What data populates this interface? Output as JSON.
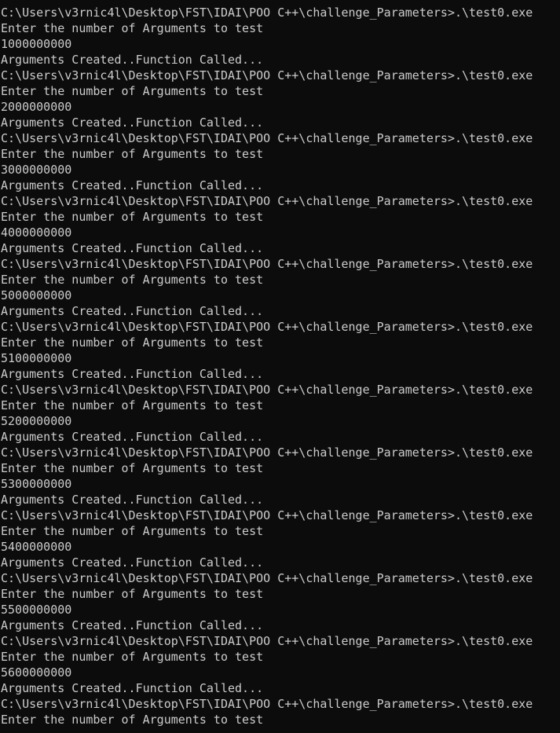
{
  "terminal": {
    "lines": [
      "C:\\Users\\v3rnic4l\\Desktop\\FST\\IDAI\\POO C++\\challenge_Parameters>.\\test0.exe",
      "Enter the number of Arguments to test",
      "1000000000",
      "Arguments Created..Function Called...",
      "C:\\Users\\v3rnic4l\\Desktop\\FST\\IDAI\\POO C++\\challenge_Parameters>.\\test0.exe",
      "Enter the number of Arguments to test",
      "2000000000",
      "Arguments Created..Function Called...",
      "C:\\Users\\v3rnic4l\\Desktop\\FST\\IDAI\\POO C++\\challenge_Parameters>.\\test0.exe",
      "Enter the number of Arguments to test",
      "3000000000",
      "Arguments Created..Function Called...",
      "C:\\Users\\v3rnic4l\\Desktop\\FST\\IDAI\\POO C++\\challenge_Parameters>.\\test0.exe",
      "Enter the number of Arguments to test",
      "4000000000",
      "Arguments Created..Function Called...",
      "C:\\Users\\v3rnic4l\\Desktop\\FST\\IDAI\\POO C++\\challenge_Parameters>.\\test0.exe",
      "Enter the number of Arguments to test",
      "5000000000",
      "Arguments Created..Function Called...",
      "C:\\Users\\v3rnic4l\\Desktop\\FST\\IDAI\\POO C++\\challenge_Parameters>.\\test0.exe",
      "Enter the number of Arguments to test",
      "5100000000",
      "Arguments Created..Function Called...",
      "C:\\Users\\v3rnic4l\\Desktop\\FST\\IDAI\\POO C++\\challenge_Parameters>.\\test0.exe",
      "Enter the number of Arguments to test",
      "5200000000",
      "Arguments Created..Function Called...",
      "C:\\Users\\v3rnic4l\\Desktop\\FST\\IDAI\\POO C++\\challenge_Parameters>.\\test0.exe",
      "Enter the number of Arguments to test",
      "5300000000",
      "Arguments Created..Function Called...",
      "C:\\Users\\v3rnic4l\\Desktop\\FST\\IDAI\\POO C++\\challenge_Parameters>.\\test0.exe",
      "Enter the number of Arguments to test",
      "5400000000",
      "Arguments Created..Function Called...",
      "C:\\Users\\v3rnic4l\\Desktop\\FST\\IDAI\\POO C++\\challenge_Parameters>.\\test0.exe",
      "Enter the number of Arguments to test",
      "5500000000",
      "Arguments Created..Function Called...",
      "C:\\Users\\v3rnic4l\\Desktop\\FST\\IDAI\\POO C++\\challenge_Parameters>.\\test0.exe",
      "Enter the number of Arguments to test",
      "5600000000",
      "Arguments Created..Function Called...",
      "C:\\Users\\v3rnic4l\\Desktop\\FST\\IDAI\\POO C++\\challenge_Parameters>.\\test0.exe",
      "Enter the number of Arguments to test"
    ]
  },
  "colors": {
    "background": "#0c0c0c",
    "foreground": "#cccccc"
  }
}
